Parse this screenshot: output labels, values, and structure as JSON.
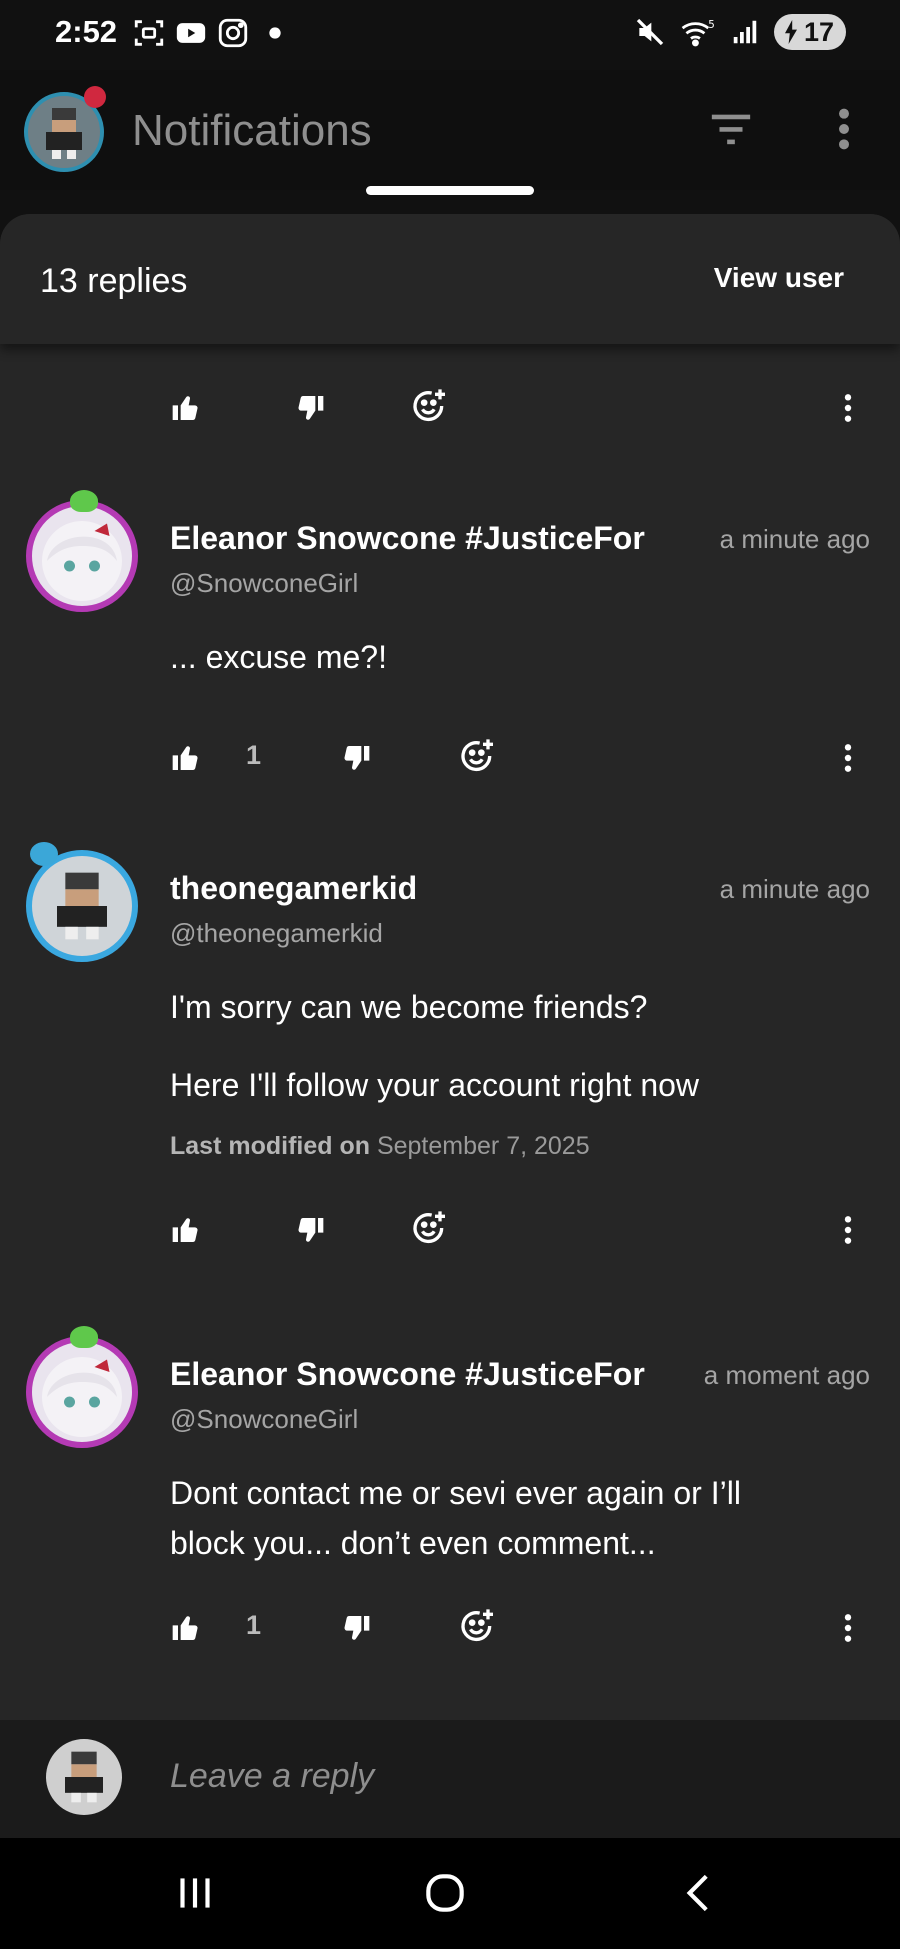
{
  "status_bar": {
    "time": "2:52",
    "battery": "17"
  },
  "app_bar": {
    "title": "Notifications"
  },
  "sheet": {
    "replies_count": "13 replies",
    "view_user": "View user"
  },
  "comments": [
    {
      "name": "Eleanor Snowcone #JusticeFor",
      "handle": "@SnowconeGirl",
      "time": "a minute ago",
      "body": "... excuse me?!",
      "likes": "1"
    },
    {
      "name": "theonegamerkid",
      "handle": "@theonegamerkid",
      "time": "a minute ago",
      "body_lines": [
        "I'm sorry can we become friends?",
        "Here I'll follow your account right now"
      ],
      "modified_label": "Last modified on",
      "modified_date": "September 7, 2025"
    },
    {
      "name": "Eleanor Snowcone #JusticeFor",
      "handle": "@SnowconeGirl",
      "time": "a moment ago",
      "body_lines": [
        "Dont contact me or sevi ever again or I’ll",
        "block you... don’t even comment..."
      ],
      "likes": "1"
    }
  ],
  "reply_bar": {
    "placeholder": "Leave a reply"
  },
  "icons": [
    "thumb-up-icon",
    "thumb-down-icon",
    "add-reaction-icon",
    "more-vert-icon",
    "filter-icon",
    "home-icon",
    "back-icon",
    "recents-icon"
  ]
}
